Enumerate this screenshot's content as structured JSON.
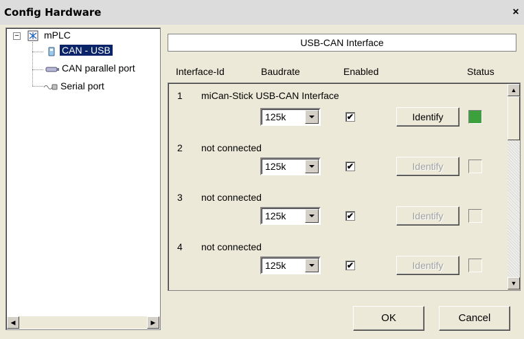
{
  "window": {
    "title": "Config Hardware",
    "close_glyph": "×"
  },
  "tree": {
    "root": {
      "label": "mPLC",
      "expander": "−",
      "icon": "network-icon"
    },
    "items": [
      {
        "label": "CAN - USB",
        "icon": "usb-icon",
        "selected": true
      },
      {
        "label": "CAN parallel port",
        "icon": "parallel-port-icon",
        "selected": false
      },
      {
        "label": "Serial port",
        "icon": "serial-port-icon",
        "selected": false
      }
    ]
  },
  "panel": {
    "title": "USB-CAN Interface",
    "columns": {
      "id": "Interface-Id",
      "baudrate": "Baudrate",
      "enabled": "Enabled",
      "status": "Status"
    }
  },
  "interfaces": [
    {
      "id": "1",
      "name": "miCan-Stick USB-CAN Interface",
      "baudrate": "125k",
      "enabled": true,
      "identify_label": "Identify",
      "identify_enabled": true,
      "status_color": "#3ca03c"
    },
    {
      "id": "2",
      "name": "not connected",
      "baudrate": "125k",
      "enabled": true,
      "identify_label": "Identify",
      "identify_enabled": false,
      "status_color": ""
    },
    {
      "id": "3",
      "name": "not connected",
      "baudrate": "125k",
      "enabled": true,
      "identify_label": "Identify",
      "identify_enabled": false,
      "status_color": ""
    },
    {
      "id": "4",
      "name": "not connected",
      "baudrate": "125k",
      "enabled": true,
      "identify_label": "Identify",
      "identify_enabled": false,
      "status_color": ""
    }
  ],
  "check_glyph": "✔",
  "buttons": {
    "ok": "OK",
    "cancel": "Cancel"
  },
  "scroll_glyphs": {
    "up": "▲",
    "down": "▼",
    "left": "◀",
    "right": "▶"
  }
}
